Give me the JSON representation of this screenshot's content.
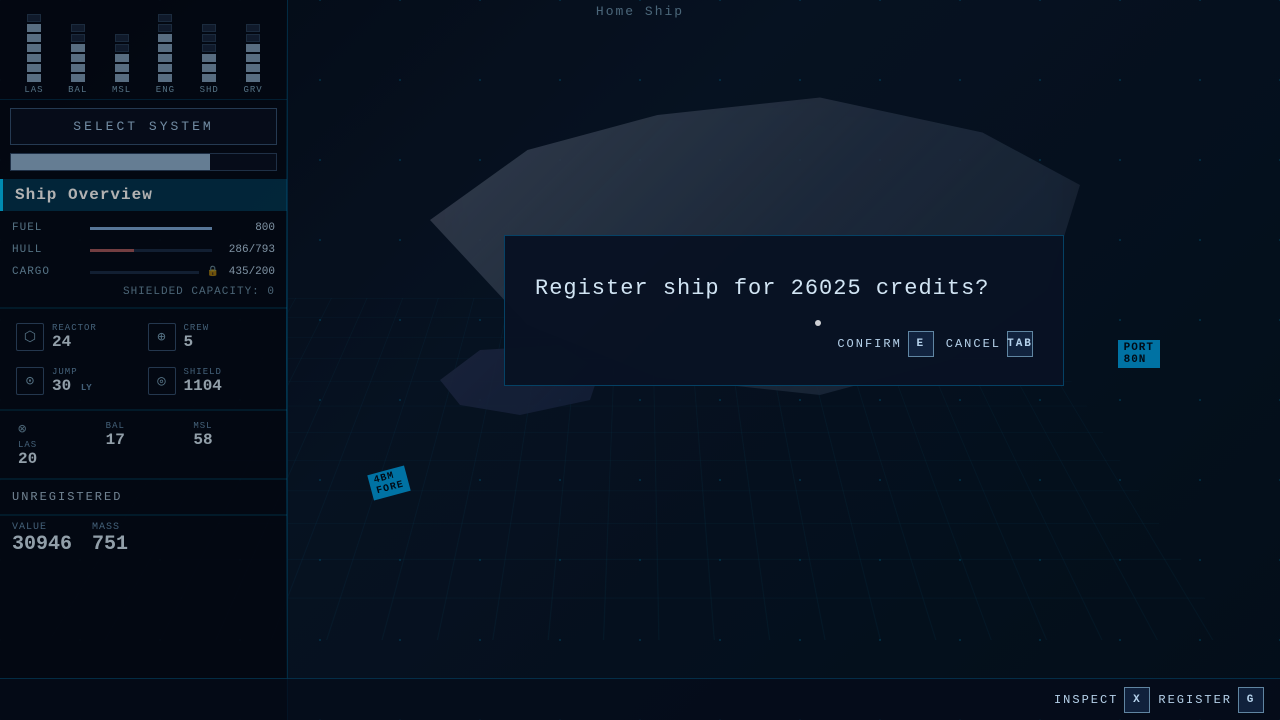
{
  "header": {
    "home_ship_label": "Home Ship"
  },
  "left_panel": {
    "system_bars": {
      "bars": [
        {
          "label": "LAS",
          "filled": 6,
          "total": 7
        },
        {
          "label": "BAL",
          "filled": 4,
          "total": 6
        },
        {
          "label": "MSL",
          "filled": 3,
          "total": 5
        },
        {
          "label": "ENG",
          "filled": 5,
          "total": 7
        },
        {
          "label": "SHD",
          "filled": 3,
          "total": 6
        },
        {
          "label": "GRV",
          "filled": 4,
          "total": 6
        }
      ]
    },
    "select_system_btn": "SELECT SYSTEM",
    "ship_overview_label": "Ship Overview",
    "stats": {
      "fuel": {
        "label": "FUEL",
        "value": "800",
        "bar_pct": 100
      },
      "hull": {
        "label": "HULL",
        "value": "286/793",
        "bar_pct": 36
      },
      "cargo": {
        "label": "CARGO",
        "value": "435/200",
        "has_lock": true
      },
      "shielded_capacity": "SHIELDED CAPACITY: 0"
    },
    "ship_stats": {
      "reactor": {
        "name": "REACTOR",
        "value": "24",
        "icon": "⬡"
      },
      "crew": {
        "name": "CREW",
        "value": "5",
        "icon": "⊕"
      },
      "jump": {
        "name": "JUMP",
        "value": "30",
        "unit": "LY",
        "icon": "⊙"
      },
      "shield": {
        "name": "SHIELD",
        "value": "1104",
        "icon": "⊗"
      }
    },
    "weapons": {
      "las": {
        "name": "LAS",
        "value": "20",
        "icon": "⊗"
      },
      "bal": {
        "name": "BAL",
        "value": "17"
      },
      "msl": {
        "name": "MSL",
        "value": "58"
      }
    },
    "registration": {
      "status": "UNREGISTERED"
    },
    "economics": {
      "value_label": "VALUE",
      "value": "30946",
      "mass_label": "MASS",
      "mass": "751"
    }
  },
  "modal": {
    "question": "Register ship for 26025 credits?",
    "confirm_label": "CONFIRM",
    "confirm_key": "E",
    "cancel_label": "CANCEL",
    "cancel_key": "TAB"
  },
  "bottom_bar": {
    "inspect_label": "INSPECT",
    "inspect_key": "X",
    "register_label": "REGISTER",
    "register_key": "G"
  },
  "map_labels": {
    "port": "PORT",
    "port_number": "80N",
    "fore": "4BM\nFORE"
  }
}
